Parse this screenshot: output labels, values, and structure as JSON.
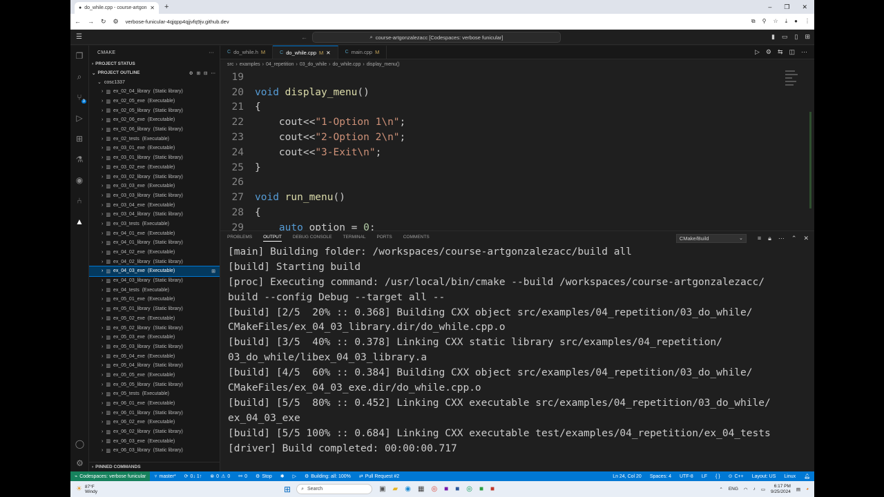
{
  "browser": {
    "tab_title": "do_while.cpp - course-artgon",
    "new_tab": "+",
    "url": "verbose-funicular-4qjqpp4qjjvfq9jv.github.dev",
    "win_controls": [
      "–",
      "❐",
      "✕"
    ]
  },
  "vscode": {
    "command_center": "course-artgonzalezacc [Codespaces: verbose funicular]"
  },
  "sidebar": {
    "title": "CMAKE",
    "sections": {
      "project_status": "PROJECT STATUS",
      "project_outline": "PROJECT OUTLINE",
      "pinned_commands": "PINNED COMMANDS"
    },
    "root": "cosc1337",
    "items": [
      {
        "name": "ex_02_04_library",
        "kind": "(Static library)"
      },
      {
        "name": "ex_02_05_exe",
        "kind": "(Executable)"
      },
      {
        "name": "ex_02_05_library",
        "kind": "(Static library)"
      },
      {
        "name": "ex_02_06_exe",
        "kind": "(Executable)"
      },
      {
        "name": "ex_02_06_library",
        "kind": "(Static library)"
      },
      {
        "name": "ex_02_tests",
        "kind": "(Executable)"
      },
      {
        "name": "ex_03_01_exe",
        "kind": "(Executable)"
      },
      {
        "name": "ex_03_01_library",
        "kind": "(Static library)"
      },
      {
        "name": "ex_03_02_exe",
        "kind": "(Executable)"
      },
      {
        "name": "ex_03_02_library",
        "kind": "(Static library)"
      },
      {
        "name": "ex_03_03_exe",
        "kind": "(Executable)"
      },
      {
        "name": "ex_03_03_library",
        "kind": "(Static library)"
      },
      {
        "name": "ex_03_04_exe",
        "kind": "(Executable)"
      },
      {
        "name": "ex_03_04_library",
        "kind": "(Static library)"
      },
      {
        "name": "ex_03_tests",
        "kind": "(Executable)"
      },
      {
        "name": "ex_04_01_exe",
        "kind": "(Executable)"
      },
      {
        "name": "ex_04_01_library",
        "kind": "(Static library)"
      },
      {
        "name": "ex_04_02_exe",
        "kind": "(Executable)"
      },
      {
        "name": "ex_04_02_library",
        "kind": "(Static library)"
      },
      {
        "name": "ex_04_03_exe",
        "kind": "(Executable)",
        "selected": true
      },
      {
        "name": "ex_04_03_library",
        "kind": "(Static library)"
      },
      {
        "name": "ex_04_tests",
        "kind": "(Executable)"
      },
      {
        "name": "ex_05_01_exe",
        "kind": "(Executable)"
      },
      {
        "name": "ex_05_01_library",
        "kind": "(Static library)"
      },
      {
        "name": "ex_05_02_exe",
        "kind": "(Executable)"
      },
      {
        "name": "ex_05_02_library",
        "kind": "(Static library)"
      },
      {
        "name": "ex_05_03_exe",
        "kind": "(Executable)"
      },
      {
        "name": "ex_05_03_library",
        "kind": "(Static library)"
      },
      {
        "name": "ex_05_04_exe",
        "kind": "(Executable)"
      },
      {
        "name": "ex_05_04_library",
        "kind": "(Static library)"
      },
      {
        "name": "ex_05_05_exe",
        "kind": "(Executable)"
      },
      {
        "name": "ex_05_05_library",
        "kind": "(Static library)"
      },
      {
        "name": "ex_05_tests",
        "kind": "(Executable)"
      },
      {
        "name": "ex_06_01_exe",
        "kind": "(Executable)"
      },
      {
        "name": "ex_06_01_library",
        "kind": "(Static library)"
      },
      {
        "name": "ex_06_02_exe",
        "kind": "(Executable)"
      },
      {
        "name": "ex_06_02_library",
        "kind": "(Static library)"
      },
      {
        "name": "ex_06_03_exe",
        "kind": "(Executable)"
      },
      {
        "name": "ex_06_03_library",
        "kind": "(Static library)"
      }
    ]
  },
  "editor": {
    "tabs": [
      {
        "label": "do_while.h",
        "modified": "M",
        "active": false
      },
      {
        "label": "do_while.cpp",
        "modified": "M",
        "active": true
      },
      {
        "label": "main.cpp",
        "modified": "M",
        "active": false
      }
    ],
    "breadcrumbs": [
      "src",
      "examples",
      "04_repetition",
      "03_do_while",
      "do_while.cpp",
      "display_menu()"
    ],
    "lines": [
      {
        "n": "19",
        "parts": []
      },
      {
        "n": "20",
        "parts": [
          [
            "kw",
            "void"
          ],
          [
            "ct",
            " "
          ],
          [
            "fn",
            "display_menu"
          ],
          [
            "ct",
            "()"
          ]
        ]
      },
      {
        "n": "21",
        "parts": [
          [
            "ct",
            "{"
          ]
        ]
      },
      {
        "n": "22",
        "parts": [
          [
            "ct",
            "    cout<<"
          ],
          [
            "str",
            "\"1-Option 1\\n\""
          ],
          [
            "ct",
            ";"
          ]
        ]
      },
      {
        "n": "23",
        "parts": [
          [
            "ct",
            "    cout<<"
          ],
          [
            "str",
            "\"2-Option 2\\n\""
          ],
          [
            "ct",
            ";"
          ]
        ]
      },
      {
        "n": "24",
        "parts": [
          [
            "ct",
            "    cout<<"
          ],
          [
            "str",
            "\"3-Exit\\n\""
          ],
          [
            "ct",
            ";"
          ]
        ]
      },
      {
        "n": "25",
        "parts": [
          [
            "ct",
            "}"
          ]
        ]
      },
      {
        "n": "26",
        "parts": []
      },
      {
        "n": "27",
        "parts": [
          [
            "kw",
            "void"
          ],
          [
            "ct",
            " "
          ],
          [
            "fn",
            "run_menu"
          ],
          [
            "ct",
            "()"
          ]
        ]
      },
      {
        "n": "28",
        "parts": [
          [
            "ct",
            "{"
          ]
        ]
      },
      {
        "n": "29",
        "parts": [
          [
            "ct",
            "    "
          ],
          [
            "kw",
            "auto"
          ],
          [
            "ct",
            " option = "
          ],
          [
            "num",
            "0"
          ],
          [
            "ct",
            ";"
          ]
        ]
      }
    ]
  },
  "panel": {
    "tabs": [
      "PROBLEMS",
      "OUTPUT",
      "DEBUG CONSOLE",
      "TERMINAL",
      "PORTS",
      "COMMENTS"
    ],
    "active_tab": "OUTPUT",
    "channel": "CMake/Build",
    "output": [
      "[main] Building folder: /workspaces/course-artgonzalezacc/build all",
      "[build] Starting build",
      "[proc] Executing command: /usr/local/bin/cmake --build /workspaces/course-artgonzalezacc/",
      "build --config Debug --target all --",
      "[build] [2/5  20% :: 0.368] Building CXX object src/examples/04_repetition/03_do_while/",
      "CMakeFiles/ex_04_03_library.dir/do_while.cpp.o",
      "[build] [3/5  40% :: 0.378] Linking CXX static library src/examples/04_repetition/",
      "03_do_while/libex_04_03_library.a",
      "[build] [4/5  60% :: 0.384] Building CXX object src/examples/04_repetition/03_do_while/",
      "CMakeFiles/ex_04_03_exe.dir/do_while.cpp.o",
      "[build] [5/5  80% :: 0.452] Linking CXX executable src/examples/04_repetition/03_do_while/",
      "ex_04_03_exe",
      "[build] [5/5 100% :: 0.684] Linking CXX executable test/examples/04_repetition/ex_04_tests",
      "[driver] Build completed: 00:00:00.717"
    ]
  },
  "status": {
    "remote": "Codespaces: verbose funicular",
    "branch": "master*",
    "sync": "0↓ 1↑",
    "errors": "0",
    "warnings": "0",
    "ports": "0",
    "stop": "Stop",
    "building": "Building: all: 100%",
    "pr": "Pull Request #2",
    "position": "Ln 24, Col 20",
    "spaces": "Spaces: 4",
    "encoding": "UTF-8",
    "eol": "LF",
    "language": "C++",
    "layout": "Layout: US",
    "os": "Linux"
  },
  "taskbar": {
    "temp": "87°F",
    "weather": "Windy",
    "search": "Search",
    "lang": "ENG",
    "time": "6:17 PM",
    "date": "9/25/2024"
  },
  "colors": {
    "accent": "#0078d4",
    "remote": "#16825d",
    "background": "#1f1f1f"
  }
}
